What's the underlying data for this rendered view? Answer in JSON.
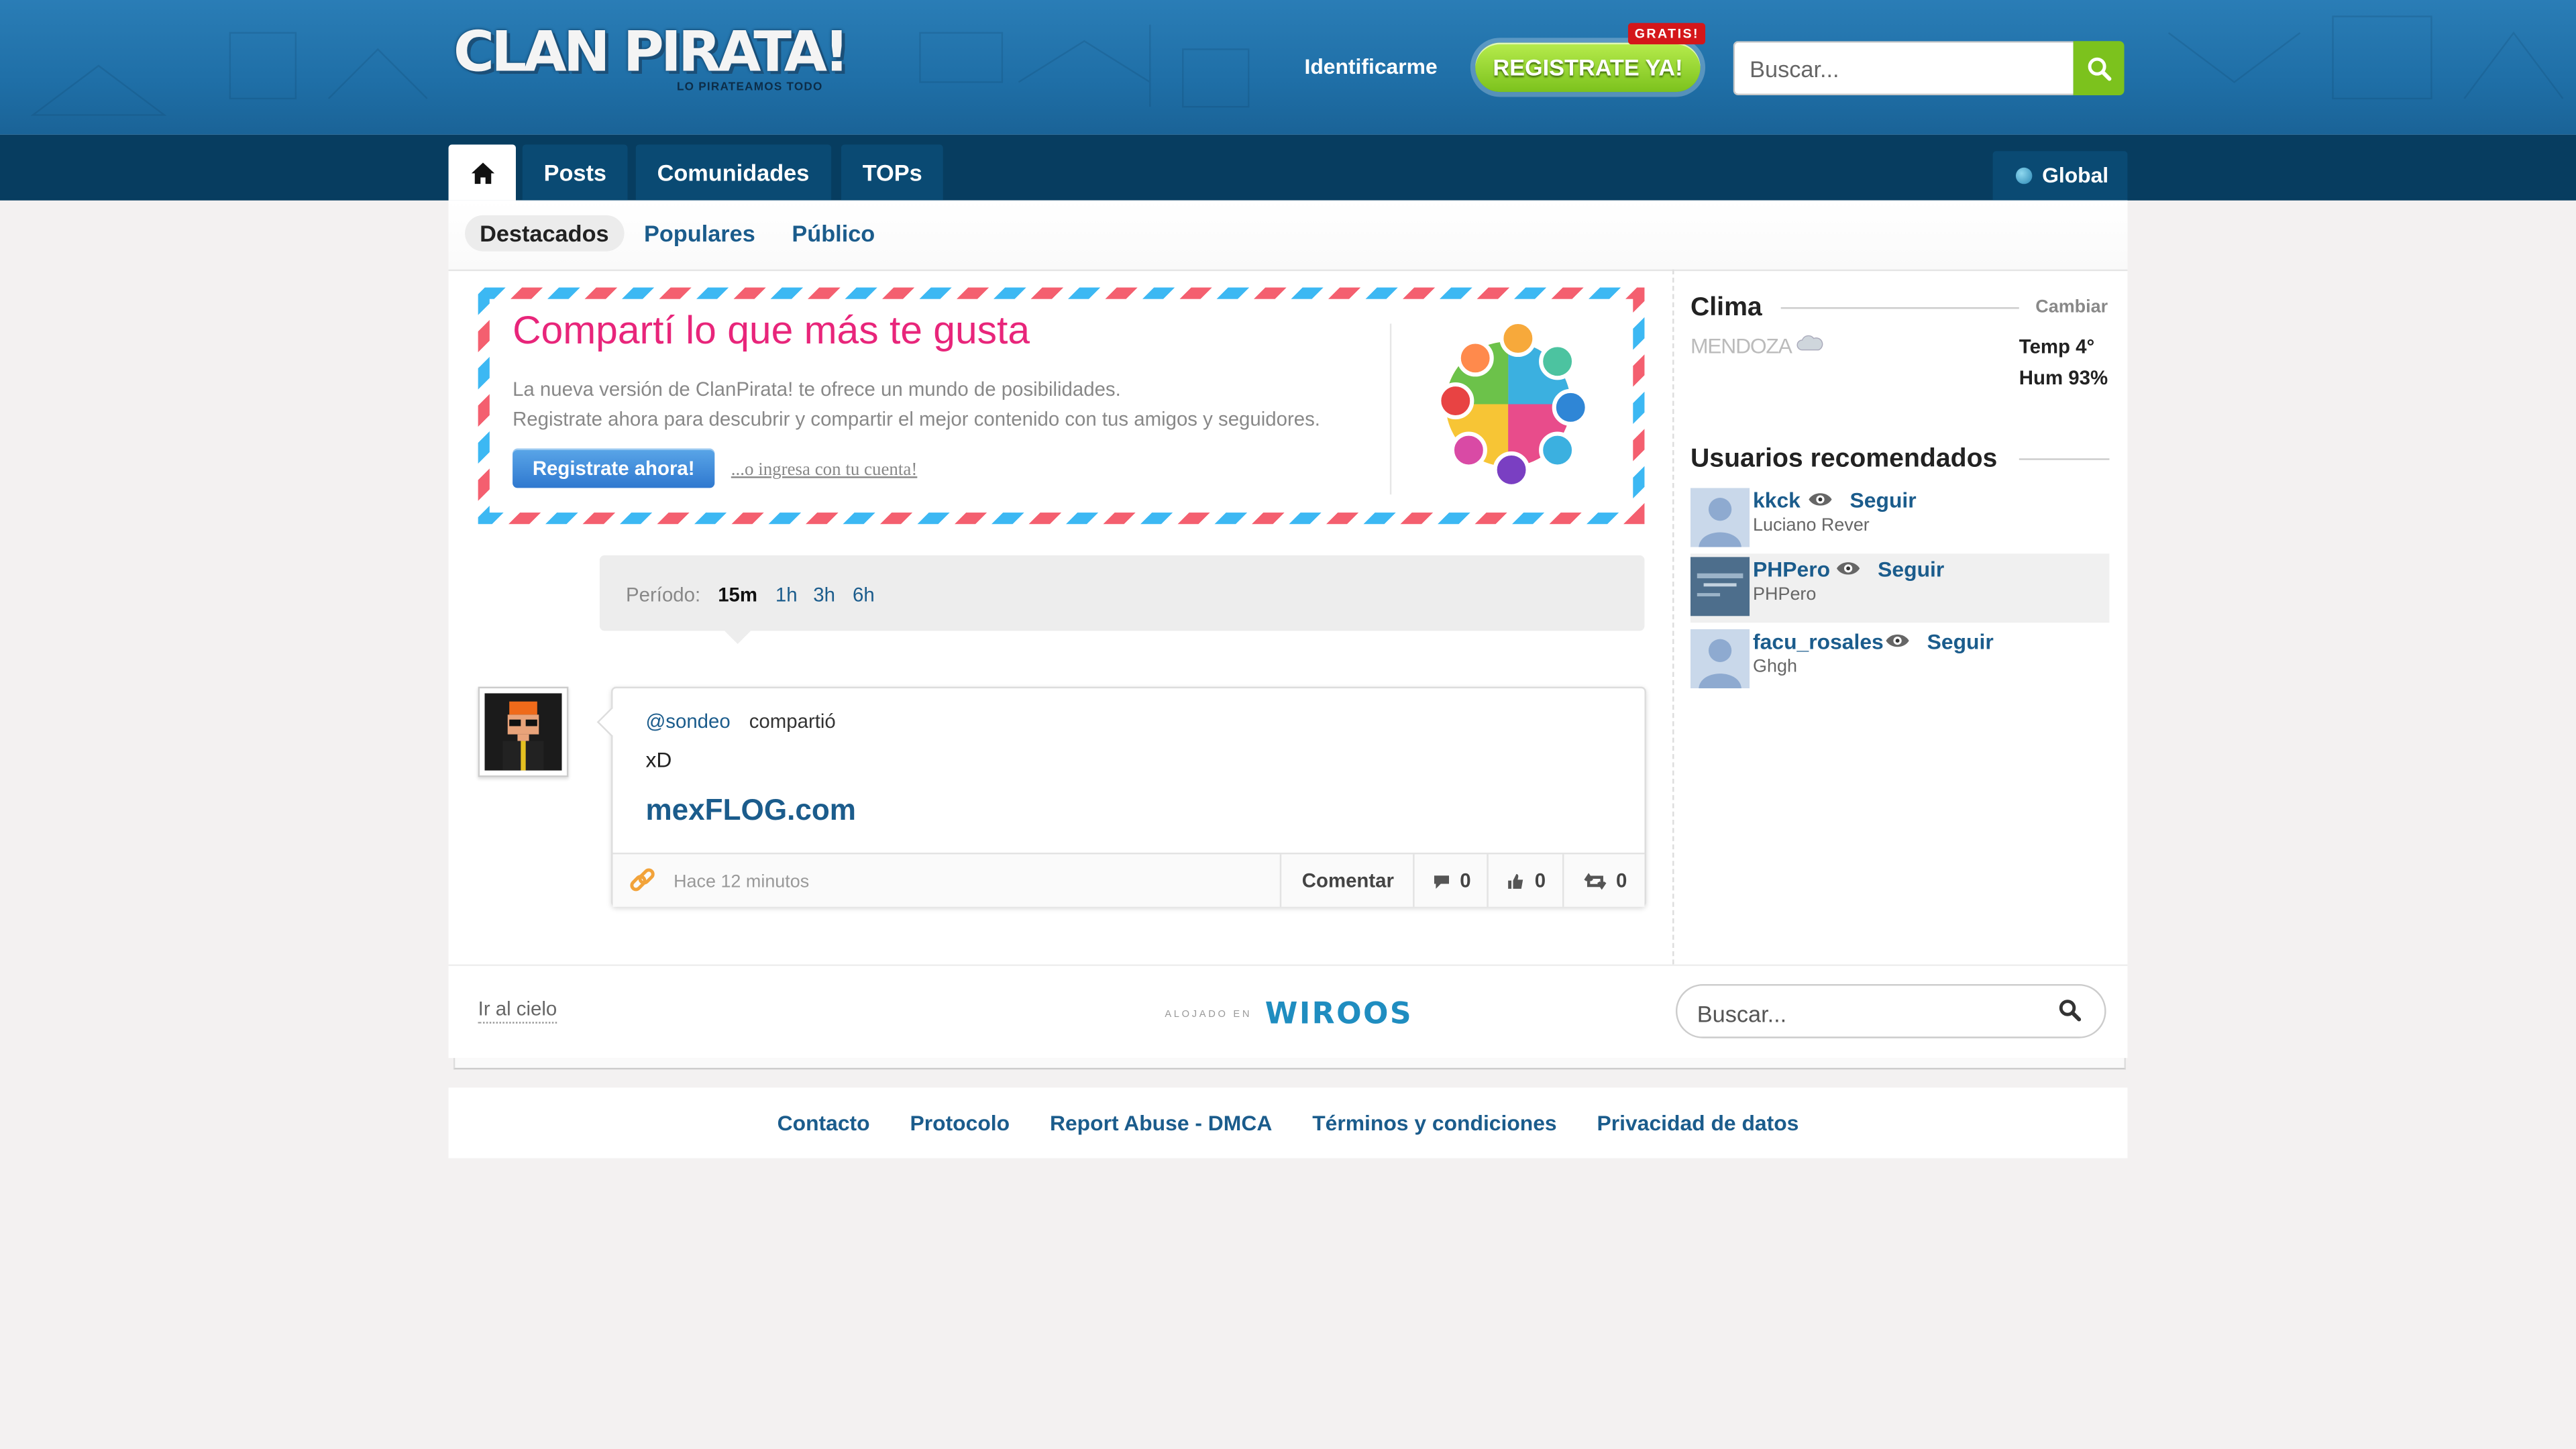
{
  "header": {
    "logo_text": "CLAN PIRATA!",
    "logo_tagline": "LO PIRATEAMOS TODO",
    "login_label": "Identificarme",
    "register_label": "REGISTRATE YA!",
    "register_badge": "GRATIS!",
    "search_placeholder": "Buscar..."
  },
  "nav": {
    "tabs": [
      {
        "label": "Posts"
      },
      {
        "label": "Comunidades"
      },
      {
        "label": "TOPs"
      }
    ],
    "region_label": "Global"
  },
  "subnav": {
    "tabs": [
      {
        "label": "Destacados",
        "active": true
      },
      {
        "label": "Populares",
        "active": false
      },
      {
        "label": "Público",
        "active": false
      }
    ]
  },
  "banner": {
    "title": "Compartí lo que más te gusta",
    "line1": "La nueva versión de ClanPirata! te ofrece un mundo de posibilidades.",
    "line2": "Registrate ahora para descubrir y compartir el mejor contenido con tus amigos y seguidores.",
    "button_label": "Registrate ahora!",
    "login_link": "...o ingresa con tu cuenta!"
  },
  "period": {
    "label": "Período:",
    "options": [
      {
        "label": "15m",
        "active": true
      },
      {
        "label": "1h",
        "active": false
      },
      {
        "label": "3h",
        "active": false
      },
      {
        "label": "6h",
        "active": false
      }
    ]
  },
  "post": {
    "user": "@sondeo",
    "action": "compartió",
    "text": "xD",
    "link": "mexFLOG.com",
    "time": "Hace 12 minutos",
    "comment_label": "Comentar",
    "comments": "0",
    "likes": "0",
    "shares": "0"
  },
  "sidebar": {
    "weather": {
      "title": "Clima",
      "change_label": "Cambiar",
      "city": "MENDOZA",
      "temp": "Temp 4°",
      "humidity": "Hum 93%"
    },
    "users": {
      "title": "Usuarios recomendados",
      "follow_label": "Seguir",
      "list": [
        {
          "name": "kkck",
          "subtitle": "Luciano Rever"
        },
        {
          "name": "PHPero",
          "subtitle": "PHPero"
        },
        {
          "name": "facu_rosales",
          "subtitle": "Ghgh"
        }
      ]
    }
  },
  "container_footer": {
    "top_link": "Ir al cielo",
    "hosted_small": "ALOJADO EN",
    "hosted_brand": "WIROOS",
    "search_placeholder": "Buscar..."
  },
  "footer": {
    "links": [
      {
        "label": "Contacto"
      },
      {
        "label": "Protocolo"
      },
      {
        "label": "Report Abuse - DMCA"
      },
      {
        "label": "Términos y condiciones"
      },
      {
        "label": "Privacidad de datos"
      }
    ]
  },
  "colors": {
    "header_bg": "#2a7db6",
    "nav_bg": "#073d60",
    "link": "#1b5c8c",
    "accent_green": "#7cc21d",
    "banner_title": "#e8257a",
    "banner_button": "#2f78cf"
  }
}
